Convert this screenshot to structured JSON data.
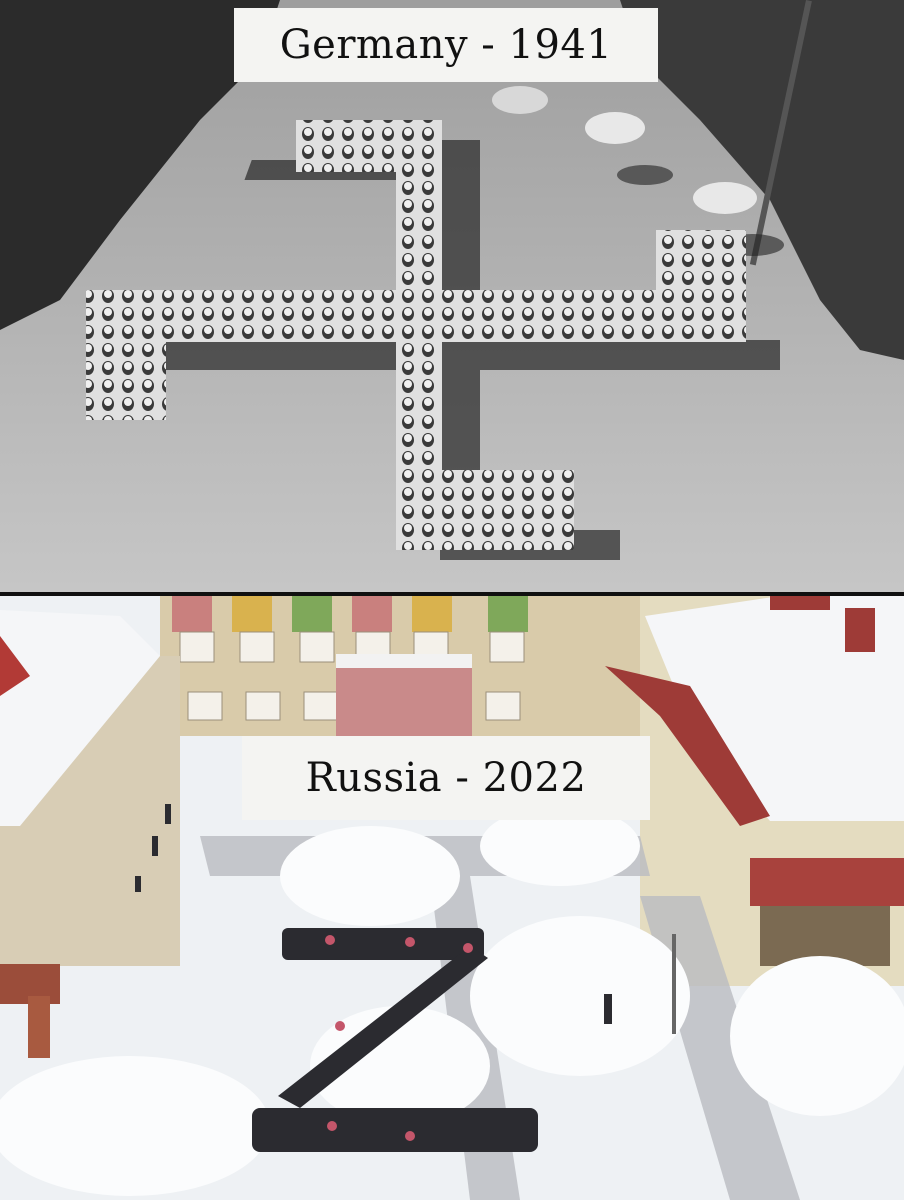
{
  "panels": {
    "top": {
      "caption": "Germany - 1941"
    },
    "bottom": {
      "caption": "Russia - 2022"
    }
  },
  "colors": {
    "top_ground": "#bdbdbd",
    "top_foliage": "#2a2a2a",
    "bottom_snow": "#f2f4f6",
    "bottom_building": "#d8c9a8",
    "bottom_roof": "#8e2a2a"
  }
}
